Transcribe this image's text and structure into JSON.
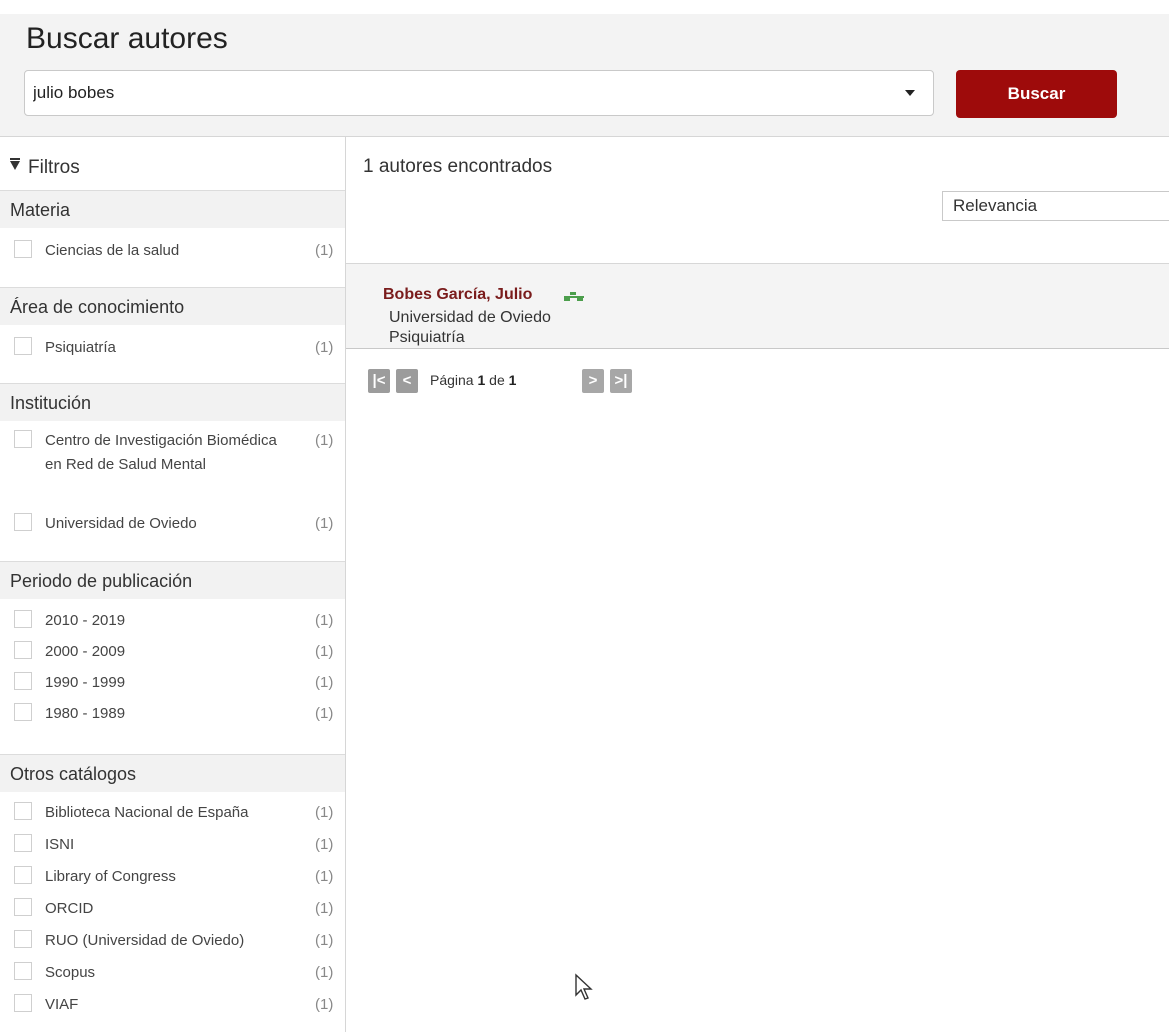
{
  "header": {
    "title": "Buscar autores",
    "search_value": "julio bobes",
    "search_button": "Buscar"
  },
  "filters": {
    "title": "Filtros",
    "facets": [
      {
        "name": "Materia",
        "items": [
          {
            "label": "Ciencias de la salud",
            "count": "(1)"
          }
        ]
      },
      {
        "name": "Área de conocimiento",
        "items": [
          {
            "label": "Psiquiatría",
            "count": "(1)"
          }
        ]
      },
      {
        "name": "Institución",
        "items": [
          {
            "label": "Centro de Investigación Biomédica en Red de Salud Mental",
            "count": "(1)"
          },
          {
            "label": "Universidad de Oviedo",
            "count": "(1)"
          }
        ]
      },
      {
        "name": "Periodo de publicación",
        "items": [
          {
            "label": "2010 - 2019",
            "count": "(1)"
          },
          {
            "label": "2000 - 2009",
            "count": "(1)"
          },
          {
            "label": "1990 - 1999",
            "count": "(1)"
          },
          {
            "label": "1980 - 1989",
            "count": "(1)"
          }
        ]
      },
      {
        "name": "Otros catálogos",
        "items": [
          {
            "label": "Biblioteca Nacional de España",
            "count": "(1)"
          },
          {
            "label": "ISNI",
            "count": "(1)"
          },
          {
            "label": "Library of Congress",
            "count": "(1)"
          },
          {
            "label": "ORCID",
            "count": "(1)"
          },
          {
            "label": "RUO (Universidad de Oviedo)",
            "count": "(1)"
          },
          {
            "label": "Scopus",
            "count": "(1)"
          },
          {
            "label": "VIAF",
            "count": "(1)"
          }
        ]
      }
    ]
  },
  "results": {
    "count_text": "1 autores encontrados",
    "sort_value": "Relevancia",
    "items": [
      {
        "name": "Bobes García, Julio",
        "institution": "Universidad de Oviedo",
        "area": "Psiquiatría"
      }
    ]
  },
  "pagination": {
    "page_word": "Página",
    "current": "1",
    "of_word": "de",
    "total": "1"
  },
  "colors": {
    "accent": "#9e0b0b",
    "author_link": "#7a1c1c",
    "tree_icon": "#4c9e4c"
  }
}
